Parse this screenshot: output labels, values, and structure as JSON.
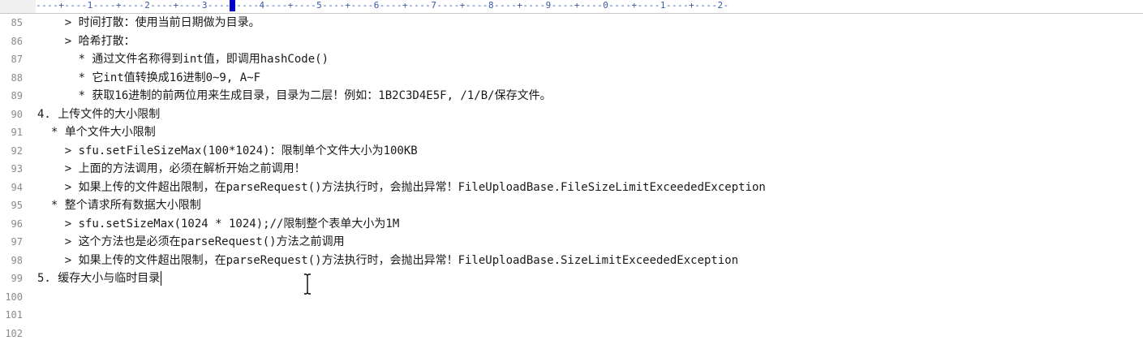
{
  "ruler": {
    "text": "----+----1----+----2----+----3----+----4----+----5----+----6----+----7----+----8----+----9----+----0----+----1----+----2-"
  },
  "lines": [
    {
      "num": "85",
      "text": "    > 时间打散：使用当前日期做为目录。"
    },
    {
      "num": "86",
      "text": "    > 哈希打散："
    },
    {
      "num": "87",
      "text": "      * 通过文件名称得到int值，即调用hashCode()"
    },
    {
      "num": "88",
      "text": "      * 它int值转换成16进制0~9, A~F"
    },
    {
      "num": "89",
      "text": "      * 获取16进制的前两位用来生成目录，目录为二层！例如：1B2C3D4E5F, /1/B/保存文件。"
    },
    {
      "num": "90",
      "text": "4. 上传文件的大小限制"
    },
    {
      "num": "91",
      "text": "  * 单个文件大小限制"
    },
    {
      "num": "92",
      "text": "    > sfu.setFileSizeMax(100*1024)：限制单个文件大小为100KB"
    },
    {
      "num": "93",
      "text": "    > 上面的方法调用，必须在解析开始之前调用！"
    },
    {
      "num": "94",
      "text": "    > 如果上传的文件超出限制，在parseRequest()方法执行时，会抛出异常！FileUploadBase.FileSizeLimitExceededException"
    },
    {
      "num": "95",
      "text": "  * 整个请求所有数据大小限制"
    },
    {
      "num": "96",
      "text": "    > sfu.setSizeMax(1024 * 1024);//限制整个表单大小为1M"
    },
    {
      "num": "97",
      "text": "    > 这个方法也是必须在parseRequest()方法之前调用"
    },
    {
      "num": "98",
      "text": "    > 如果上传的文件超出限制，在parseRequest()方法执行时，会抛出异常！FileUploadBase.SizeLimitExceededException"
    },
    {
      "num": "99",
      "text": "5. 缓存大小与临时目录"
    },
    {
      "num": "100",
      "text": ""
    },
    {
      "num": "101",
      "text": ""
    },
    {
      "num": "102",
      "text": ""
    }
  ],
  "colors": {
    "text": "#1a1a1a",
    "line_number": "#8a8a8a",
    "ruler_text": "#3a5aa8",
    "ruler_caret": "#0000cc"
  }
}
